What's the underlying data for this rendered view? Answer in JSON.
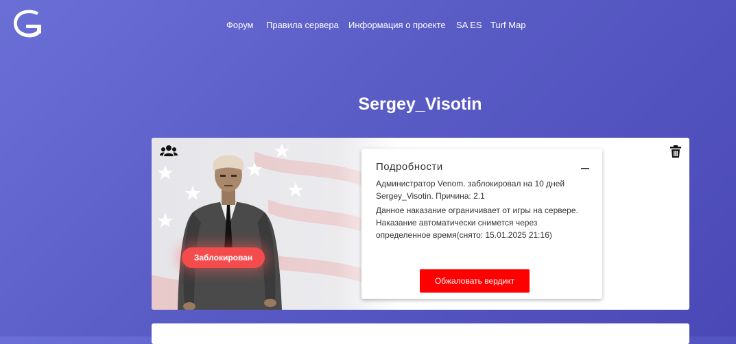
{
  "nav": {
    "items": [
      {
        "label": "Форум"
      },
      {
        "label": "Правила сервера"
      },
      {
        "label": "Информация о проекте"
      },
      {
        "label": "SA ES"
      },
      {
        "label": "Turf Map"
      }
    ]
  },
  "profile": {
    "name": "Sergey_Visotin",
    "status": "Заблокирован"
  },
  "details": {
    "title": "Подробности",
    "text_1": "Администратор Venom. заблокировал на 10 дней Sergey_Visotin. Причина: 2.1",
    "text_2": "Данное наказание ограничивает от игры на сервере. Наказание автоматически снимется через определенное время(снято: 15.01.2025 21:16)",
    "appeal_label": "Обжаловать вердикт"
  },
  "icons": {
    "logo": "logo-icon",
    "group": "users-icon",
    "delete": "trash-icon",
    "collapse": "minus-icon"
  },
  "colors": {
    "background_start": "#6a6fd6",
    "background_end": "#4a48b6",
    "accent_red": "#ff0000",
    "badge_red": "#f44c4c"
  }
}
